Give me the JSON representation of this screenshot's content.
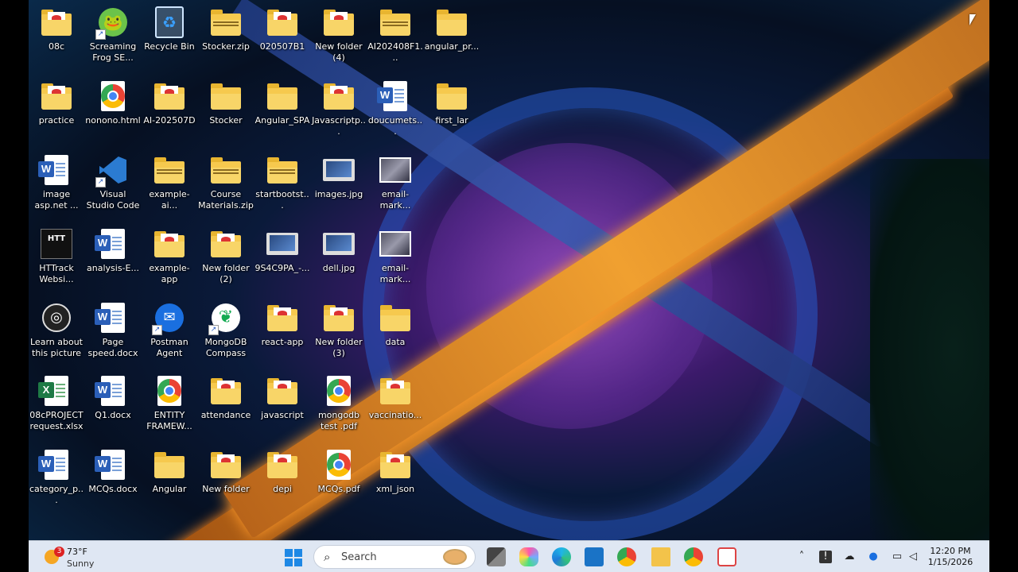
{
  "desktop": {
    "icons": [
      {
        "label": "08c",
        "type": "folder-paper"
      },
      {
        "label": "Screaming Frog SE...",
        "type": "frog"
      },
      {
        "label": "Recycle Bin",
        "type": "recycle"
      },
      {
        "label": "Stocker.zip",
        "type": "zip"
      },
      {
        "label": "020507B1",
        "type": "folder-paper"
      },
      {
        "label": "New folder (4)",
        "type": "folder-paper"
      },
      {
        "label": "AI202408F1...",
        "type": "zip"
      },
      {
        "label": "angular_pr...",
        "type": "folder"
      },
      {
        "label": "practice",
        "type": "folder-paper"
      },
      {
        "label": "nonono.html",
        "type": "chrome"
      },
      {
        "label": "AI-202507D",
        "type": "folder-paper"
      },
      {
        "label": "Stocker",
        "type": "folder"
      },
      {
        "label": "Angular_SPA",
        "type": "folder"
      },
      {
        "label": "Javascriptp...",
        "type": "folder-paper"
      },
      {
        "label": "doucumets...",
        "type": "word"
      },
      {
        "label": "first_lar",
        "type": "folder"
      },
      {
        "label": "image asp.net ...",
        "type": "word"
      },
      {
        "label": "Visual Studio Code",
        "type": "vscode"
      },
      {
        "label": "example-ai...",
        "type": "zip"
      },
      {
        "label": "Course Materials.zip",
        "type": "zip"
      },
      {
        "label": "startbootst...",
        "type": "zip"
      },
      {
        "label": "images.jpg",
        "type": "laptop"
      },
      {
        "label": "email-mark...",
        "type": "photo"
      },
      {
        "label": "HTTrack Websi...",
        "type": "httrack"
      },
      {
        "label": "analysis-E...",
        "type": "word"
      },
      {
        "label": "example-app",
        "type": "folder-paper"
      },
      {
        "label": "New folder (2)",
        "type": "folder-paper"
      },
      {
        "label": "9S4C9PA_-...",
        "type": "laptop"
      },
      {
        "label": "dell.jpg",
        "type": "laptop"
      },
      {
        "label": "email-mark...",
        "type": "photo"
      },
      {
        "label": "Learn about this picture",
        "type": "learn"
      },
      {
        "label": "Page speed.docx",
        "type": "word"
      },
      {
        "label": "Postman Agent",
        "type": "postman"
      },
      {
        "label": "MongoDB Compass",
        "type": "mongo"
      },
      {
        "label": "react-app",
        "type": "folder-paper"
      },
      {
        "label": "New folder (3)",
        "type": "folder-paper"
      },
      {
        "label": "data",
        "type": "folder"
      },
      {
        "label": "08cPROJECT request.xlsx",
        "type": "excel"
      },
      {
        "label": "Q1.docx",
        "type": "word"
      },
      {
        "label": "ENTITY FRAMEW...",
        "type": "chrome"
      },
      {
        "label": "attendance",
        "type": "folder-paper"
      },
      {
        "label": "javascript",
        "type": "folder-paper"
      },
      {
        "label": "mongodb test .pdf",
        "type": "chrome"
      },
      {
        "label": "vaccinatio...",
        "type": "folder-paper"
      },
      {
        "label": "category_p...",
        "type": "word"
      },
      {
        "label": "MCQs.docx",
        "type": "word"
      },
      {
        "label": "Angular",
        "type": "folder"
      },
      {
        "label": "New folder",
        "type": "folder-paper"
      },
      {
        "label": "depi",
        "type": "folder-paper"
      },
      {
        "label": "MCQs.pdf",
        "type": "chrome"
      },
      {
        "label": "xml_json",
        "type": "folder-paper"
      }
    ]
  },
  "taskbar": {
    "weather": {
      "temp": "73°F",
      "condition": "Sunny",
      "badge": "3"
    },
    "search": {
      "placeholder": "Search"
    },
    "pinned": [
      "task-view-icon",
      "copilot-icon",
      "edge-icon",
      "store-icon",
      "chrome-icon",
      "file-explorer-icon",
      "chrome-profile-icon",
      "snipping-tool-icon"
    ],
    "tray": [
      "chevron-up-icon",
      "security-icon",
      "cloud-off-icon",
      "microphone-icon",
      "network-icon",
      "volume-icon"
    ],
    "clock": {
      "time": "12:20 PM",
      "date": "1/15/2026"
    }
  },
  "colors": {
    "taskbar": "#dfe7f3",
    "folder": "#f6c94e",
    "accent": "#1e88e5"
  }
}
